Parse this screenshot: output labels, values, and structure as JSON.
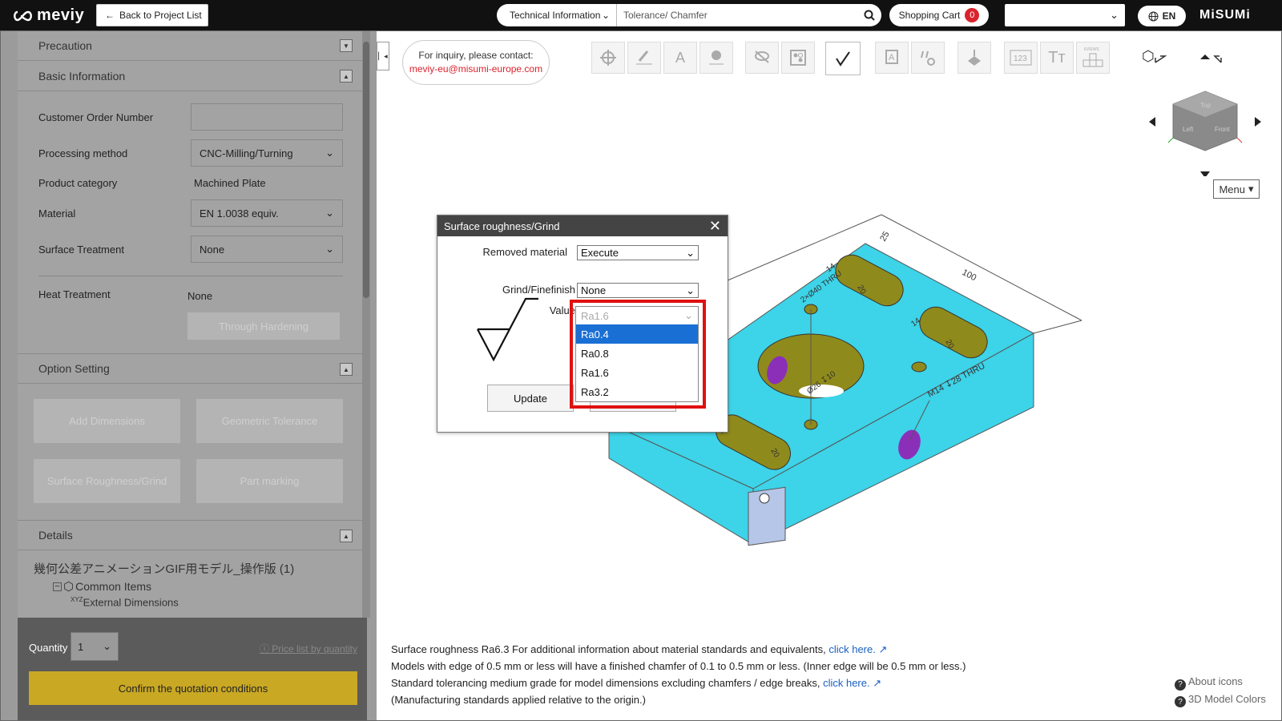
{
  "header": {
    "logo": "meviy",
    "back_label": "Back to Project List",
    "search_category": "Technical Information",
    "search_value": "Tolerance/ Chamfer",
    "cart_label": "Shopping Cart",
    "cart_count": "0",
    "lang": "EN",
    "brand": "MiSUMi"
  },
  "sidebar": {
    "sections": {
      "precaution": "Precaution",
      "basic_info": "Basic Information",
      "option_setting": "Option Setting",
      "details": "Details"
    },
    "fields": {
      "customer_order_label": "Customer Order Number",
      "customer_order_value": "",
      "processing_label": "Processing method",
      "processing_value": "CNC-Milling/Turning",
      "category_label": "Product category",
      "category_value": "Machined Plate",
      "material_label": "Material",
      "material_value": "EN 1.0038 equiv.",
      "surface_label": "Surface Treatment",
      "surface_value": "None",
      "heat_label": "Heat Treatment",
      "heat_value": "None",
      "through_hardening": "Through Hardening"
    },
    "options": {
      "add_dimensions": "Add Dimensions",
      "geometric_tolerance": "Geometric Tolerance",
      "surface_roughness": "Surface Roughness/Grind",
      "part_marking": "Part marking"
    },
    "details": {
      "model_name": "幾何公差アニメーションGIF用モデル_操作版 (1)",
      "common_items": "Common Items",
      "xyz": "XYZ",
      "external_dimensions": "External Dimensions"
    },
    "quantity_label": "Quantity",
    "quantity_value": "1",
    "price_link": "Price list by quantity",
    "confirm_label": "Confirm the quotation conditions"
  },
  "inquiry": {
    "text": "For inquiry, please contact:",
    "email": "meviy-eu@misumi-europe.com"
  },
  "toolbar": {
    "icons": [
      "target-icon",
      "pencil-icon",
      "text-a-icon",
      "hole-icon",
      "hide-icon",
      "pattern-icon",
      "roughness-icon",
      "annotation-icon",
      "tolerance-icon",
      "weld-icon",
      "numbering-icon",
      "font-size-icon",
      "views-icon"
    ],
    "views_text": "6VIEWS",
    "numbering_text": "123"
  },
  "viewer": {
    "menu_label": "Menu",
    "cube_top": "Top",
    "cube_front": "Front",
    "cube_left": "Left",
    "dims": {
      "d100": "100",
      "d25": "25",
      "d14a": "14",
      "d14b": "14",
      "d14c": "14",
      "d20a": "20",
      "d20b": "20",
      "d20c": "20",
      "d_hole": "2×Ø40 THRU",
      "d_bore": "Ø26 ↧10",
      "d_thread": "M14 ↧28 THRU"
    }
  },
  "dialog": {
    "title": "Surface roughness/Grind",
    "removed_label": "Removed material",
    "removed_value": "Execute",
    "grind_label": "Grind/Finefinish",
    "grind_value": "None",
    "value_label": "Value",
    "value_current": "Ra1.6",
    "options": [
      "Ra0.4",
      "Ra0.8",
      "Ra1.6",
      "Ra3.2"
    ],
    "selected_option": "Ra0.4",
    "update_label": "Update",
    "cancel_label": "Cancel"
  },
  "notes": {
    "line1_prefix": "Surface roughness Ra6.3    For additional information about material standards and equivalents, ",
    "line1_link": "click here.",
    "line2": "Models with edge of 0.5 mm or less will have a finished chamfer of 0.1 to 0.5 mm or less. (Inner edge will be 0.5 mm or less.)",
    "line3_prefix": "Standard tolerancing medium grade for model dimensions excluding chamfers / edge breaks, ",
    "line3_link": "click here.",
    "line4": "(Manufacturing standards applied relative to the origin.)"
  },
  "help": {
    "about_icons": "About icons",
    "model_colors": "3D Model Colors"
  },
  "colors": {
    "accent_yellow": "#c9a824",
    "highlight_red": "#e01010",
    "model_cyan": "#3dd3e8",
    "hole_olive": "#8f8a1c",
    "select_blue": "#1a6fd4"
  }
}
